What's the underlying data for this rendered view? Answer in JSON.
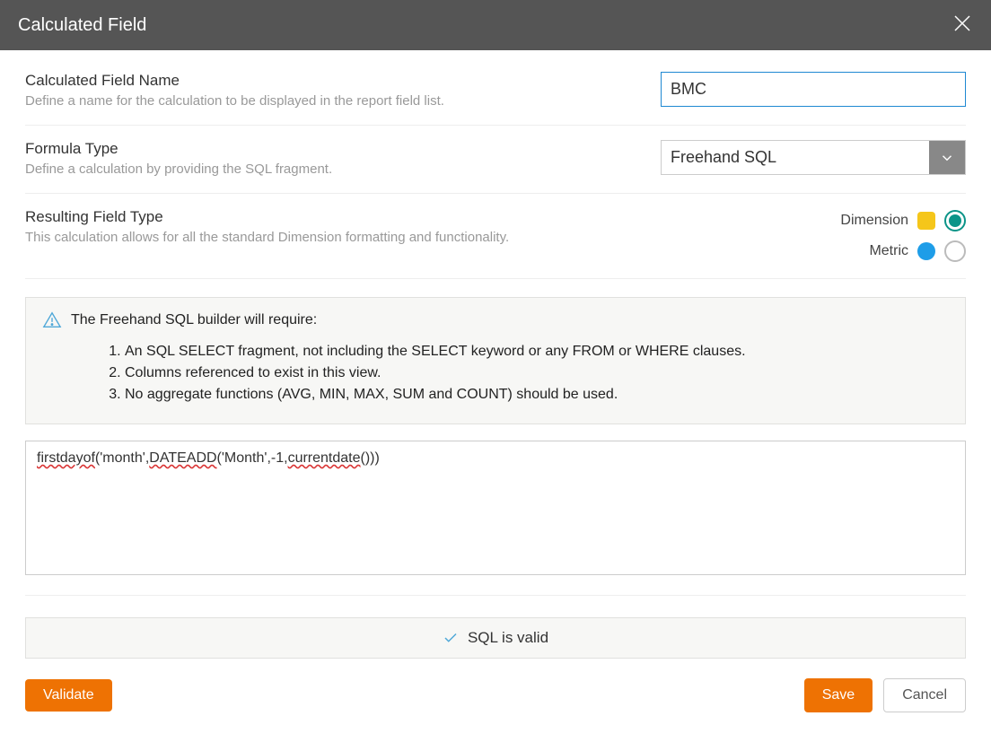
{
  "header": {
    "title": "Calculated Field"
  },
  "fields": {
    "name": {
      "label": "Calculated Field Name",
      "desc": "Define a name for the calculation to be displayed in the report field list.",
      "value": "BMC"
    },
    "formula": {
      "label": "Formula Type",
      "desc": "Define a calculation by providing the SQL fragment.",
      "value": "Freehand SQL"
    },
    "resultType": {
      "label": "Resulting Field Type",
      "desc": "This calculation allows for all the standard Dimension formatting and functionality.",
      "options": [
        {
          "label": "Dimension",
          "swatch": "yellow",
          "selected": true
        },
        {
          "label": "Metric",
          "swatch": "blue",
          "selected": false
        }
      ]
    }
  },
  "info": {
    "intro": "The Freehand SQL builder will require:",
    "items": [
      "An SQL SELECT fragment, not including the SELECT keyword or any FROM or WHERE clauses.",
      "Columns referenced to exist in this view.",
      "No aggregate functions (AVG, MIN, MAX, SUM and COUNT) should be used."
    ]
  },
  "sql": {
    "tokens": [
      {
        "t": "firstdayof",
        "wavy": true
      },
      {
        "t": "('month',",
        "wavy": false
      },
      {
        "t": "DATEADD",
        "wavy": true
      },
      {
        "t": "('Month',-1,",
        "wavy": false
      },
      {
        "t": "currentdate",
        "wavy": true
      },
      {
        "t": "()))",
        "wavy": false
      }
    ]
  },
  "status": {
    "text": "SQL is valid"
  },
  "buttons": {
    "validate": "Validate",
    "save": "Save",
    "cancel": "Cancel"
  }
}
